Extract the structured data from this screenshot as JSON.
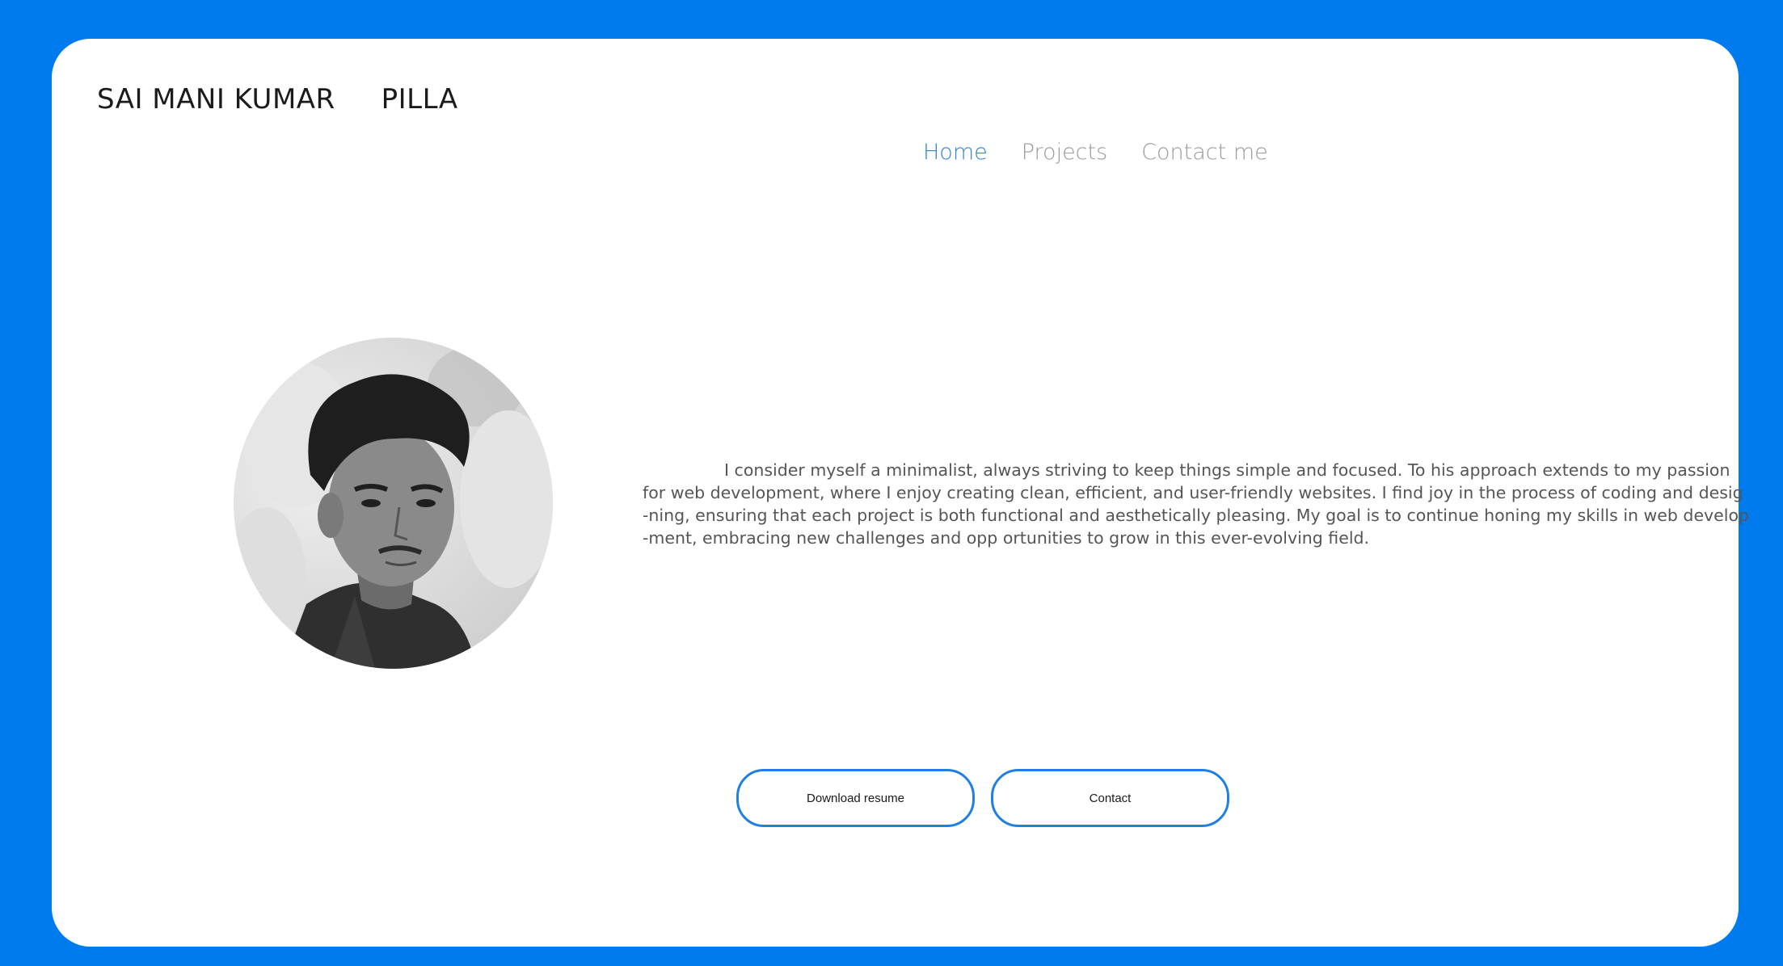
{
  "header": {
    "first_name": "SAI MANI KUMAR",
    "last_name": "PILLA"
  },
  "nav": {
    "items": [
      {
        "label": "Home",
        "active": true
      },
      {
        "label": "Projects",
        "active": false
      },
      {
        "label": "Contact me",
        "active": false
      }
    ]
  },
  "profile": {
    "photo": "profile-photo"
  },
  "bio": {
    "lines": [
      "I consider myself a minimalist, always striving to keep things simple and focused. To his approach extends to my passion",
      "for web development, where I enjoy creating clean, efficient, and user-friendly websites. I find joy in the process of coding and desig",
      "-ning, ensuring that each project is both functional and aesthetically pleasing. My goal is to continue honing my skills in web develop",
      "-ment, embracing new challenges and opp ortunities to grow in this ever-evolving field."
    ]
  },
  "actions": {
    "download_label": "Download resume",
    "contact_label": "Contact"
  },
  "colors": {
    "background": "#007BEF",
    "accent": "#2D83DF",
    "nav_inactive": "#9A9A9A"
  }
}
